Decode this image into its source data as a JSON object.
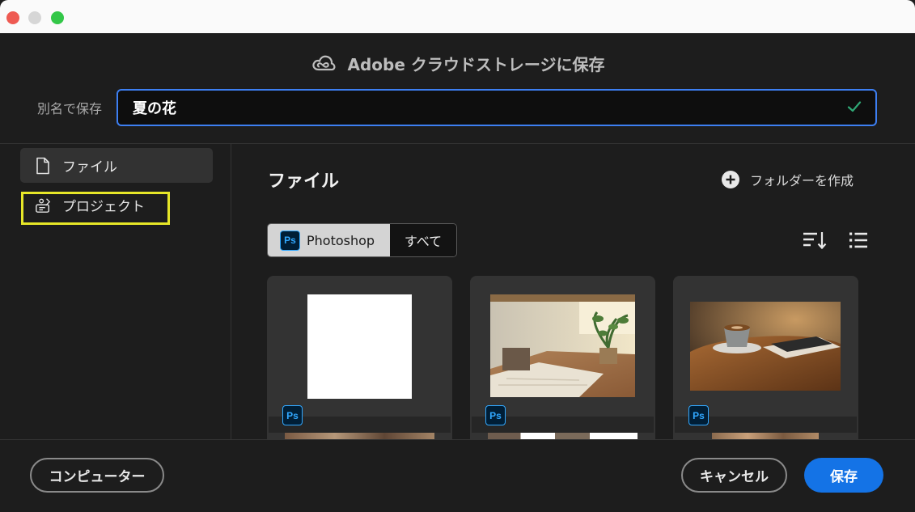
{
  "window": {
    "traffic_lights": [
      "close",
      "minimize",
      "maximize"
    ]
  },
  "dialog": {
    "title": "Adobe クラウドストレージに保存",
    "title_icon": "creative-cloud-icon",
    "save_as_label": "別名で保存",
    "filename_value": "夏の花",
    "valid_icon": "check-icon"
  },
  "sidebar": {
    "items": [
      {
        "label": "ファイル",
        "icon": "file-icon",
        "selected": true
      },
      {
        "label": "プロジェクト",
        "icon": "project-icon",
        "selected": false,
        "highlighted": true
      }
    ]
  },
  "main": {
    "section_title": "ファイル",
    "create_folder_label": "フォルダーを作成",
    "filters": [
      {
        "label": "Photoshop",
        "badge": "Ps",
        "selected": true
      },
      {
        "label": "すべて",
        "selected": false
      }
    ],
    "sort_icon": "sort-icon",
    "view_icon": "list-view-icon",
    "files": [
      {
        "thumbnail": "blank-white-canvas",
        "badge": "Ps"
      },
      {
        "thumbnail": "cafe-table-with-plant",
        "badge": "Ps"
      },
      {
        "thumbnail": "coffee-cup-on-table",
        "badge": "Ps"
      }
    ]
  },
  "footer": {
    "computer_label": "コンピューター",
    "cancel_label": "キャンセル",
    "save_label": "保存"
  },
  "colors": {
    "accent": "#1473e6",
    "input_border": "#3d7ff2",
    "highlight": "#e6e628",
    "ps_badge": "#31a8ff",
    "background": "#1d1d1d"
  }
}
